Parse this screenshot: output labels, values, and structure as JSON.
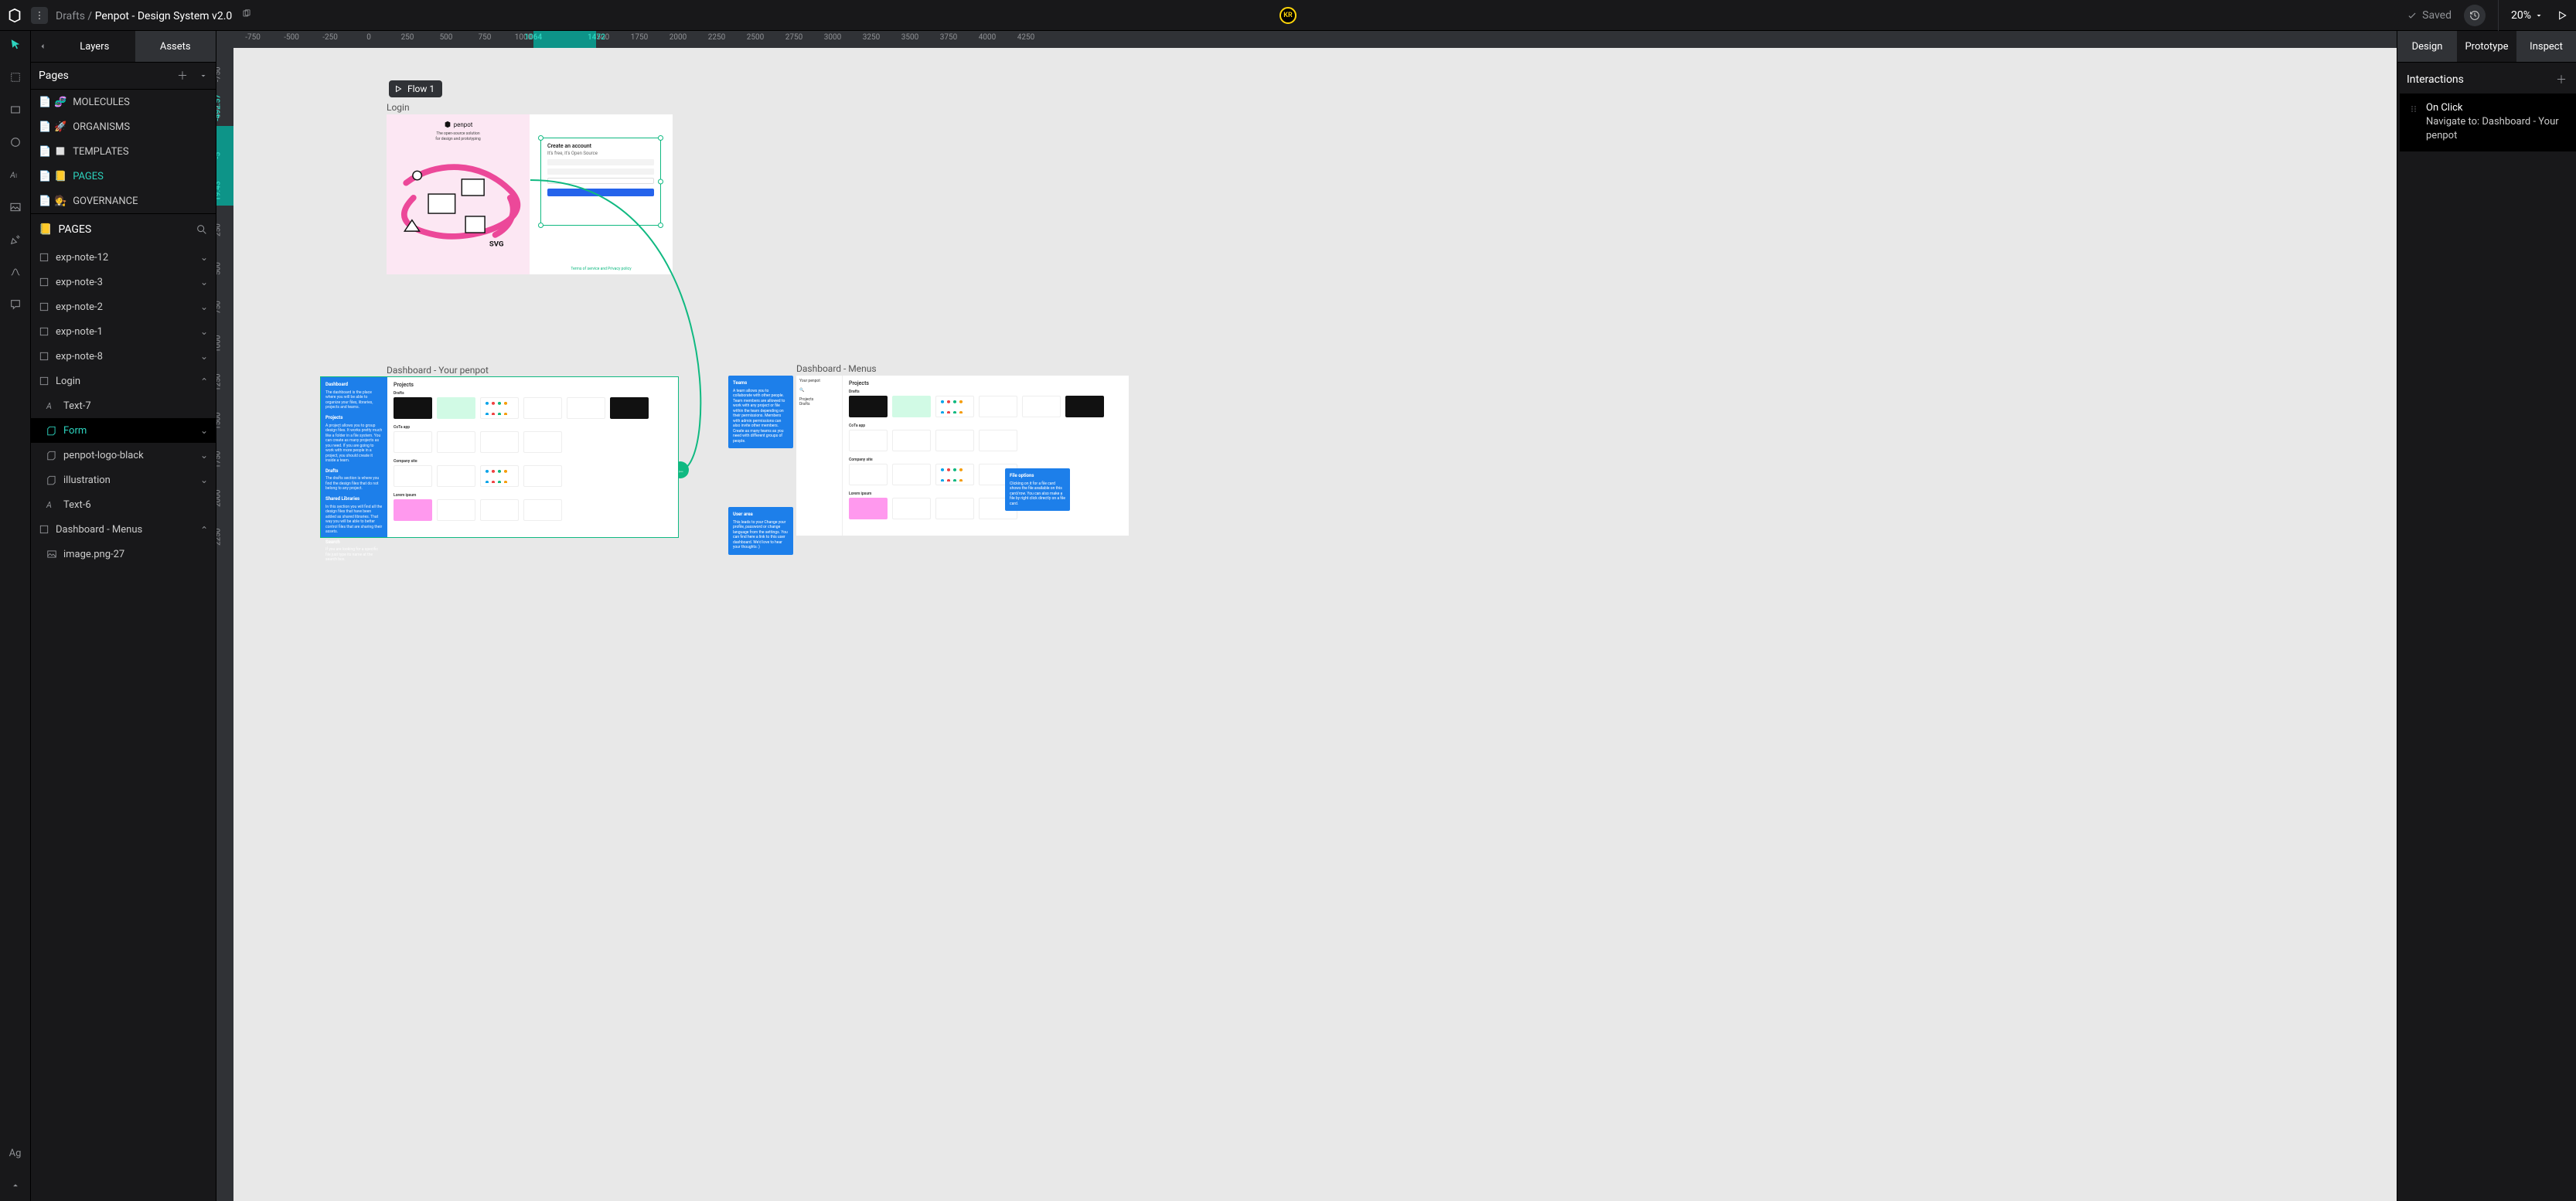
{
  "topbar": {
    "breadcrumb_root": "Drafts",
    "breadcrumb_sep": " / ",
    "breadcrumb_current": "Penpot - Design System v2.0",
    "avatar_initials": "KR",
    "saved_label": "Saved",
    "zoom_label": "20%"
  },
  "left_panel": {
    "tabs": {
      "back": "‹",
      "layers": "Layers",
      "assets": "Assets"
    },
    "pages_header": "Pages",
    "pages": [
      {
        "emoji": "🧬",
        "label": "MOLECULES"
      },
      {
        "emoji": "🚀",
        "label": "ORGANISMS"
      },
      {
        "emoji": "◻️",
        "label": "TEMPLATES"
      },
      {
        "emoji": "📒",
        "label": "PAGES",
        "active": true
      },
      {
        "emoji": "🧑‍⚖️",
        "label": "GOVERNANCE"
      }
    ],
    "tree_header": {
      "emoji": "📒",
      "label": "PAGES"
    },
    "tree": [
      {
        "icon": "frame",
        "label": "exp-note-12",
        "state": "collapsed",
        "depth": 0
      },
      {
        "icon": "frame",
        "label": "exp-note-3",
        "state": "collapsed",
        "depth": 0
      },
      {
        "icon": "frame",
        "label": "exp-note-2",
        "state": "collapsed",
        "depth": 0
      },
      {
        "icon": "frame",
        "label": "exp-note-1",
        "state": "collapsed",
        "depth": 0
      },
      {
        "icon": "frame",
        "label": "exp-note-8",
        "state": "collapsed",
        "depth": 0
      },
      {
        "icon": "frame",
        "label": "Login",
        "state": "open",
        "depth": 0
      },
      {
        "icon": "text",
        "label": "Text-7",
        "state": "none",
        "depth": 1
      },
      {
        "icon": "group",
        "label": "Form",
        "state": "collapsed",
        "depth": 1,
        "selected": true
      },
      {
        "icon": "group",
        "label": "penpot-logo-black",
        "state": "collapsed",
        "depth": 1
      },
      {
        "icon": "group",
        "label": "illustration",
        "state": "collapsed",
        "depth": 1
      },
      {
        "icon": "text",
        "label": "Text-6",
        "state": "none",
        "depth": 1
      },
      {
        "icon": "frame",
        "label": "Dashboard - Menus",
        "state": "open",
        "depth": 0
      },
      {
        "icon": "image",
        "label": "image.png-27",
        "state": "none",
        "depth": 1
      }
    ]
  },
  "ruler": {
    "h_ticks": [
      -750,
      -500,
      -250,
      0,
      250,
      500,
      750,
      1000,
      1250,
      1500,
      1750,
      2000,
      2250,
      2500,
      2750,
      3000,
      3250,
      3500,
      3750,
      4000,
      4250
    ],
    "h_sel": [
      1064,
      1472
    ],
    "v_ticks": [
      -1000,
      -750,
      -500,
      -250,
      0,
      250,
      500,
      750,
      1000,
      1250,
      1500,
      1750,
      2000,
      2250
    ],
    "v_sel_labels": [
      "-492.57",
      "19.43"
    ],
    "v_sel_mid": "-5"
  },
  "canvas": {
    "flow_tag": "Flow 1",
    "frames": [
      {
        "key": "login",
        "label": "Login"
      },
      {
        "key": "dash_yp",
        "label": "Dashboard - Your penpot"
      },
      {
        "key": "dash_menus",
        "label": "Dashboard - Menus"
      }
    ],
    "login": {
      "brand": "penpot",
      "tagline_l1": "The open-source solution",
      "tagline_l2": "for design and prototyping",
      "form_title": "Create an account",
      "form_sub": "It's free, it's Open Source",
      "footer": "Terms of service and Privacy policy"
    },
    "dashboard": {
      "side_headings": [
        "Dashboard",
        "Projects",
        "Drafts",
        "Shared Libraries",
        "Search"
      ],
      "side_body": {
        "Dashboard": "The dashboard is the place where you will be able to organize your files, libraries, projects and teams.",
        "Projects": "A project allows you to group design files. It works pretty much like a folder in a file system. You can create as many projects as you need. If you are going to work with more people in a project, you should create it inside a team.",
        "Drafts": "The drafts section is where you find the design files that do not belong to any project.",
        "Shared Libraries": "In this section you will find all the design files that have been added as shared libraries. That way you will be able to better control files that are sharing their assets.",
        "Search": "If you are looking for a specific file just type its name at the search box."
      },
      "projects_label": "Projects",
      "row_titles": [
        "Drafts",
        "CoTa app",
        "Company site",
        "Lorem ipsum"
      ]
    },
    "menus": {
      "teams_title": "Teams",
      "teams_body": "A team allows you to collaborate with other people. Team members are allowed to work with any project or file within the team depending on their permissions. Members with admin permissions can also invite other members.\nCreate as many teams as you need with different groups of people.",
      "user_title": "User area",
      "user_body": "This leads to your Change your profile, password or change language from the settings.\nYou can find here a link to this user dashboard. We'd love to hear your thoughts :)",
      "file_title": "File options",
      "file_body": "Clicking on it for a file card shows the file available on this card/row. You can also make a file by right click directly on a file card."
    }
  },
  "right_panel": {
    "tabs": [
      "Design",
      "Prototype",
      "Inspect"
    ],
    "active_tab": "Prototype",
    "interactions_label": "Interactions",
    "interaction": {
      "trigger": "On Click",
      "action_prefix": "Navigate to: ",
      "destination": "Dashboard - Your penpot"
    }
  }
}
